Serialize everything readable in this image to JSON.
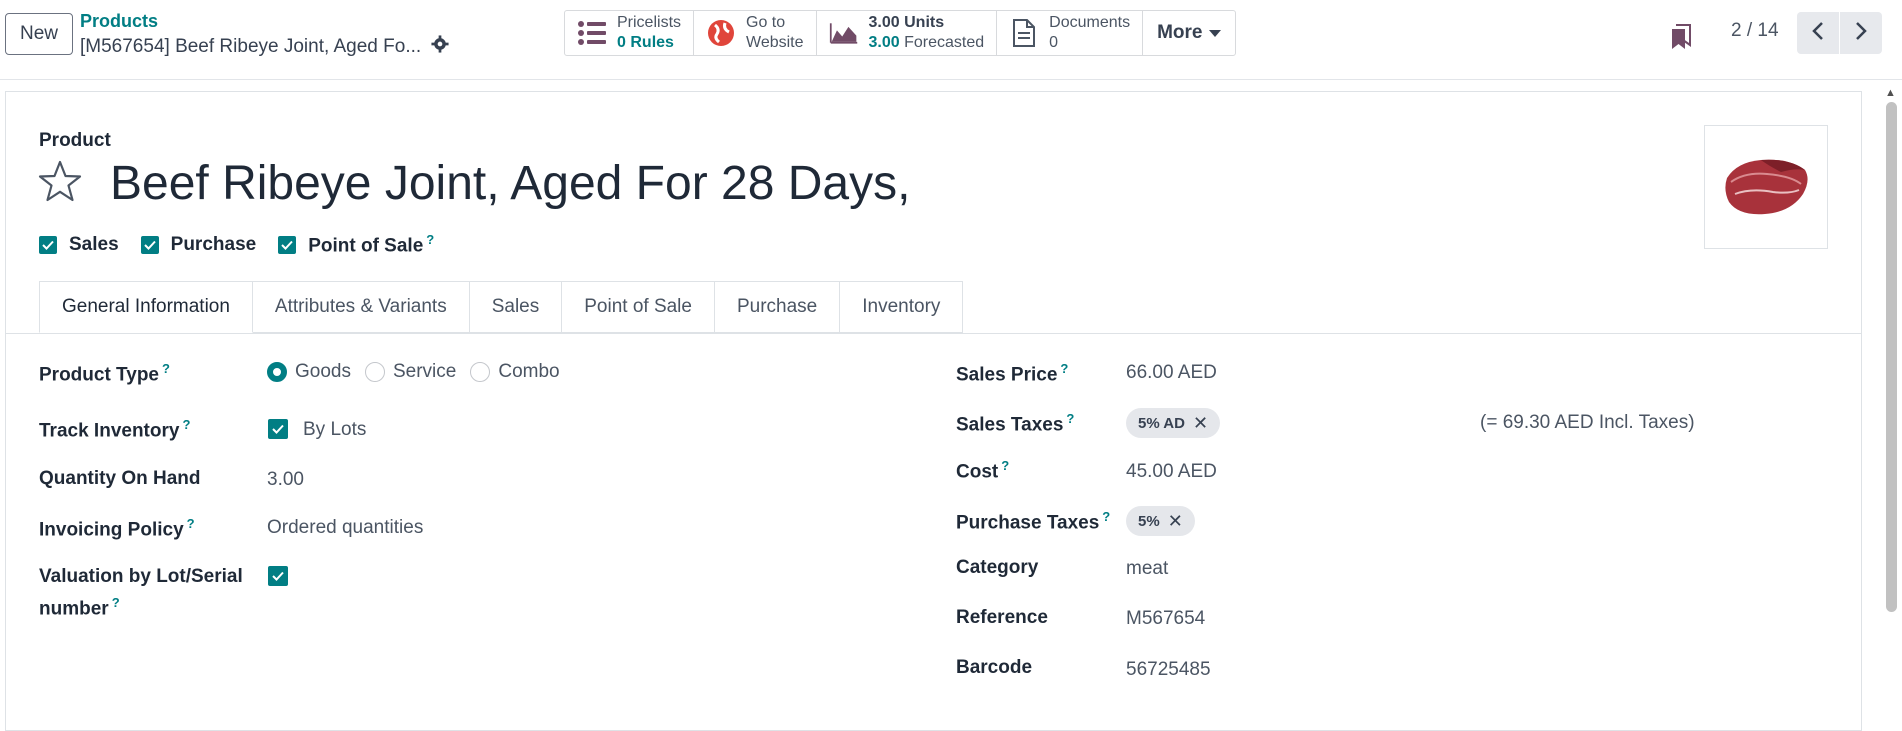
{
  "topbar": {
    "new_label": "New",
    "breadcrumb": "Products",
    "record_title": "[M567654] Beef Ribeye Joint, Aged Fo...",
    "smart_buttons": {
      "pricelists_title": "Pricelists",
      "pricelists_count": "0",
      "pricelists_unit": "Rules",
      "website_line1": "Go to",
      "website_line2": "Website",
      "units_value": "3.00",
      "units_label": "Units",
      "forecast_value": "3.00",
      "forecast_label": "Forecasted",
      "documents_title": "Documents",
      "documents_count": "0",
      "more_label": "More"
    },
    "pager": "2 / 14"
  },
  "product": {
    "section_label": "Product",
    "name": "Beef Ribeye Joint, Aged For 28 Days,",
    "flags": [
      "Sales",
      "Purchase",
      "Point of Sale"
    ]
  },
  "tabs": [
    "General Information",
    "Attributes & Variants",
    "Sales",
    "Point of Sale",
    "Purchase",
    "Inventory"
  ],
  "left_fields": {
    "product_type_label": "Product Type",
    "product_type_options": [
      "Goods",
      "Service",
      "Combo"
    ],
    "product_type_selected": "Goods",
    "track_inventory_label": "Track Inventory",
    "track_inventory_value": "By Lots",
    "qty_label": "Quantity On Hand",
    "qty_value": "3.00",
    "invoicing_label": "Invoicing Policy",
    "invoicing_value": "Ordered quantities",
    "valuation_label_1": "Valuation by Lot/Serial",
    "valuation_label_2": "number"
  },
  "right_fields": {
    "sales_price_label": "Sales Price",
    "sales_price_value": "66.00 AED",
    "sales_taxes_label": "Sales Taxes",
    "sales_taxes_tag": "5% AD",
    "sales_taxes_incl": "(= 69.30 AED Incl. Taxes)",
    "cost_label": "Cost",
    "cost_value": "45.00 AED",
    "purchase_taxes_label": "Purchase Taxes",
    "purchase_taxes_tag": "5%",
    "category_label": "Category",
    "category_value": "meat",
    "reference_label": "Reference",
    "reference_value": "M567654",
    "barcode_label": "Barcode",
    "barcode_value": "56725485"
  },
  "colors": {
    "accent": "#017e84",
    "brand": "#714b67"
  }
}
